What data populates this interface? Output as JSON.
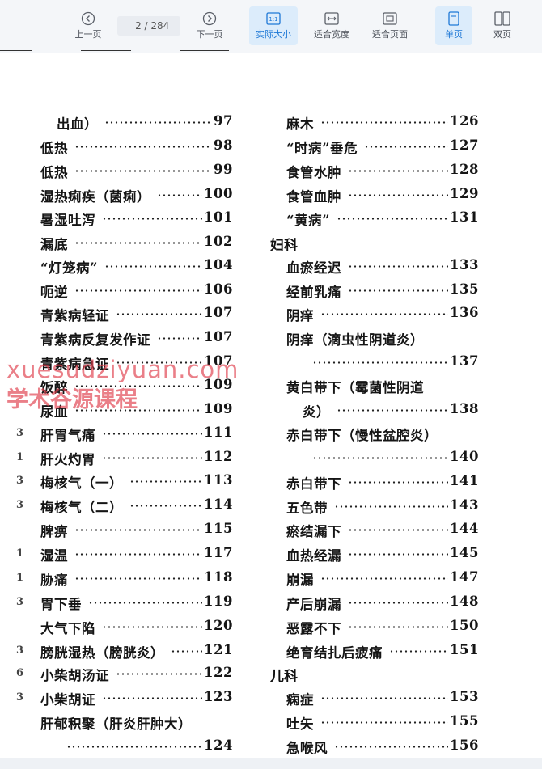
{
  "toolbar": {
    "prev_label": "上一页",
    "next_label": "下一页",
    "current_page": "2",
    "total_pages": "/ 284",
    "actual_size_label": "实际大小",
    "fit_width_label": "适合宽度",
    "fit_page_label": "适合页面",
    "single_page_label": "单页",
    "double_page_label": "双页",
    "accent_color": "#1e78d6"
  },
  "watermark": {
    "line1": "xuesudziyuan.com",
    "line2": "学术谷源课程"
  },
  "left_column": [
    {
      "text": "出血）",
      "page": "97"
    },
    {
      "text": "低热",
      "page": "98"
    },
    {
      "text": "低热",
      "page": "99"
    },
    {
      "text": "湿热痢疾（菌痢）",
      "page": "100"
    },
    {
      "text": "暑湿吐泻",
      "page": "101"
    },
    {
      "text": "漏底",
      "page": "102"
    },
    {
      "text": "“灯笼病”",
      "page": "104"
    },
    {
      "text": "呃逆",
      "page": "106"
    },
    {
      "text": "青紫病轻证",
      "page": "107"
    },
    {
      "text": "青紫病反复发作证",
      "page": "107"
    },
    {
      "text": "青紫病急证",
      "page": "107"
    },
    {
      "text": "饭醉",
      "page": "109"
    },
    {
      "text": "尿血",
      "page": "109"
    },
    {
      "text": "肝胃气痛",
      "page": "111"
    },
    {
      "text": "肝火灼胃",
      "page": "112"
    },
    {
      "text": "梅核气（一）",
      "page": "113"
    },
    {
      "text": "梅核气（二）",
      "page": "114"
    },
    {
      "text": "脾痹",
      "page": "115"
    },
    {
      "text": "湿温",
      "page": "117"
    },
    {
      "text": "胁痛",
      "page": "118"
    },
    {
      "text": "胃下垂",
      "page": "119"
    },
    {
      "text": "大气下陷",
      "page": "120"
    },
    {
      "text": "膀胱湿热（膀胱炎）",
      "page": "121"
    },
    {
      "text": "小柴胡汤证",
      "page": "122"
    },
    {
      "text": "小柴胡证",
      "page": "123"
    },
    {
      "text": "肝郁积聚（肝炎肝肿大）",
      "page": ""
    },
    {
      "text": "",
      "page": "124"
    }
  ],
  "right_column": [
    {
      "text": "麻木",
      "page": "126"
    },
    {
      "text": "“时病”垂危",
      "page": "127"
    },
    {
      "text": "食管水肿",
      "page": "128"
    },
    {
      "text": "食管血肿",
      "page": "129"
    },
    {
      "text": "“黄病”",
      "page": "131"
    },
    {
      "text": "血瘀经迟",
      "page": "133"
    },
    {
      "text": "经前乳痛",
      "page": "135"
    },
    {
      "text": "阴痒",
      "page": "136"
    },
    {
      "text": "阴痒（滴虫性阴道炎）",
      "page": ""
    },
    {
      "text": "",
      "page": "137"
    },
    {
      "text": "黄白带下（霉菌性阴道",
      "page": ""
    },
    {
      "text": "炎）",
      "page": "138"
    },
    {
      "text": "赤白带下（慢性盆腔炎）",
      "page": ""
    },
    {
      "text": "",
      "page": "140"
    },
    {
      "text": "赤白带下",
      "page": "141"
    },
    {
      "text": "五色带",
      "page": "143"
    },
    {
      "text": "瘀结漏下",
      "page": "144"
    },
    {
      "text": "血热经漏",
      "page": "145"
    },
    {
      "text": "崩漏",
      "page": "147"
    },
    {
      "text": "产后崩漏",
      "page": "148"
    },
    {
      "text": "恶露不下",
      "page": "150"
    },
    {
      "text": "绝育结扎后疲痛",
      "page": "151"
    },
    {
      "text": "痫症",
      "page": "153"
    },
    {
      "text": "吐矢",
      "page": "155"
    },
    {
      "text": "急喉风",
      "page": "156"
    }
  ],
  "sections": {
    "gynecology": "妇科",
    "pediatrics": "儿科"
  },
  "margin_marks": [
    "3",
    "1",
    "3",
    "3",
    "1",
    "1",
    "3",
    "3",
    "6",
    "3"
  ]
}
